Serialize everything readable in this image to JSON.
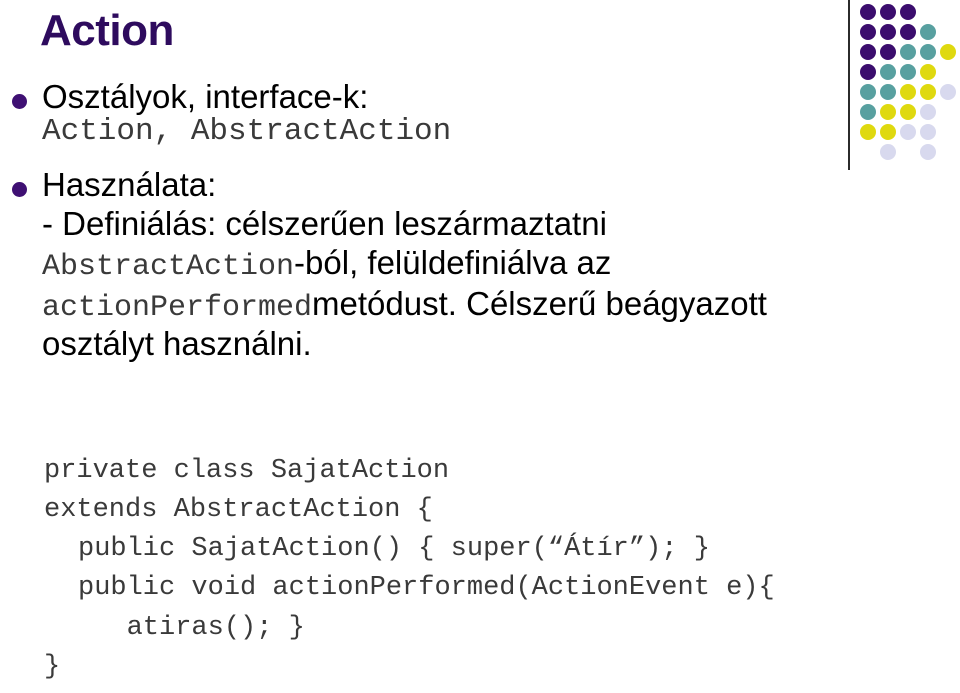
{
  "slide": {
    "title": "Action",
    "colors": {
      "title_purple": "#2e0b5e",
      "bullet_purple": "#3f1073",
      "deco_dark_purple": "#3b0d6e",
      "deco_teal": "#58a0a0",
      "deco_yellow": "#dfd90f",
      "deco_lavender": "#d8d9ee",
      "code_gray": "#3a3a3a",
      "rule_dark": "#2b2b2b",
      "background": "#ffffff"
    },
    "bullets": [
      {
        "label": "Osztályok, interface-k:",
        "code": "Action, AbstractAction"
      },
      {
        "label": "Használata:"
      }
    ],
    "usage": {
      "part1": "- Definiálás: célszerűen leszármaztatni",
      "code1": "AbstractAction",
      "part2": "-ból, felüldefiniálva az",
      "code2": "actionPerformed",
      "part3": "metódust. Célszerű beágyazott osztályt használni."
    },
    "code_block": [
      {
        "text": "private class SajatAction",
        "indent": 0
      },
      {
        "text": "extends AbstractAction {",
        "indent": 0
      },
      {
        "text": "public SajatAction() { super(“Átír”); }",
        "indent": 1
      },
      {
        "text": "public void actionPerformed(ActionEvent e){",
        "indent": 1
      },
      {
        "text": "   atiras(); }",
        "indent": 1
      },
      {
        "text": "}",
        "indent": 0
      }
    ],
    "decoration": {
      "name": "dot-grid-gradient",
      "cols": 5,
      "rows": 8,
      "cell": 20,
      "dots": [
        {
          "c": 0,
          "r": 0,
          "color": "#3b0d6e"
        },
        {
          "c": 1,
          "r": 0,
          "color": "#3b0d6e"
        },
        {
          "c": 2,
          "r": 0,
          "color": "#3b0d6e"
        },
        {
          "c": 0,
          "r": 1,
          "color": "#3b0d6e"
        },
        {
          "c": 1,
          "r": 1,
          "color": "#3b0d6e"
        },
        {
          "c": 2,
          "r": 1,
          "color": "#3b0d6e"
        },
        {
          "c": 3,
          "r": 1,
          "color": "#58a0a0"
        },
        {
          "c": 0,
          "r": 2,
          "color": "#3b0d6e"
        },
        {
          "c": 1,
          "r": 2,
          "color": "#3b0d6e"
        },
        {
          "c": 2,
          "r": 2,
          "color": "#58a0a0"
        },
        {
          "c": 3,
          "r": 2,
          "color": "#58a0a0"
        },
        {
          "c": 4,
          "r": 2,
          "color": "#dfd90f"
        },
        {
          "c": 0,
          "r": 3,
          "color": "#3b0d6e"
        },
        {
          "c": 1,
          "r": 3,
          "color": "#58a0a0"
        },
        {
          "c": 2,
          "r": 3,
          "color": "#58a0a0"
        },
        {
          "c": 3,
          "r": 3,
          "color": "#dfd90f"
        },
        {
          "c": 0,
          "r": 4,
          "color": "#58a0a0"
        },
        {
          "c": 1,
          "r": 4,
          "color": "#58a0a0"
        },
        {
          "c": 2,
          "r": 4,
          "color": "#dfd90f"
        },
        {
          "c": 3,
          "r": 4,
          "color": "#dfd90f"
        },
        {
          "c": 4,
          "r": 4,
          "color": "#d8d9ee"
        },
        {
          "c": 0,
          "r": 5,
          "color": "#58a0a0"
        },
        {
          "c": 1,
          "r": 5,
          "color": "#dfd90f"
        },
        {
          "c": 2,
          "r": 5,
          "color": "#dfd90f"
        },
        {
          "c": 3,
          "r": 5,
          "color": "#d8d9ee"
        },
        {
          "c": 0,
          "r": 6,
          "color": "#dfd90f"
        },
        {
          "c": 1,
          "r": 6,
          "color": "#dfd90f"
        },
        {
          "c": 2,
          "r": 6,
          "color": "#d8d9ee"
        },
        {
          "c": 3,
          "r": 6,
          "color": "#d8d9ee"
        },
        {
          "c": 1,
          "r": 7,
          "color": "#d8d9ee"
        },
        {
          "c": 3,
          "r": 7,
          "color": "#d8d9ee"
        }
      ]
    }
  }
}
